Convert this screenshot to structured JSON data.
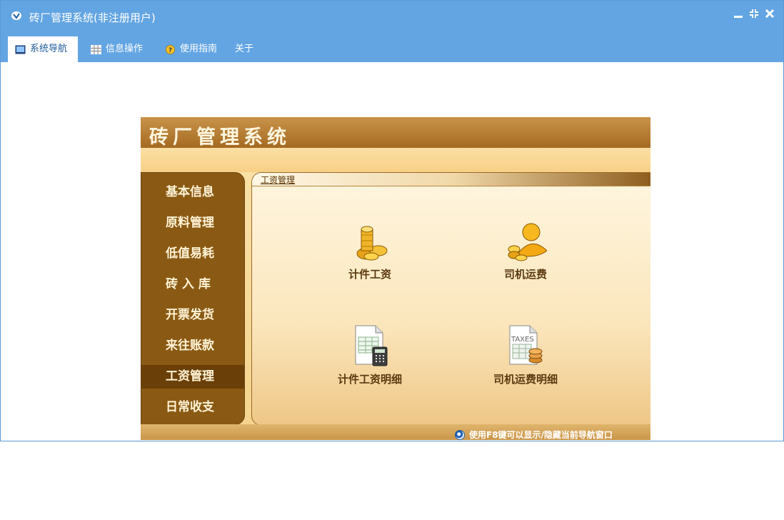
{
  "window": {
    "title": "砖厂管理系统(非注册用户)",
    "controls": {
      "minimize": "minimize-icon",
      "restore": "restore-icon",
      "close": "close-icon"
    }
  },
  "menu": {
    "items": [
      {
        "label": "系统导航",
        "icon": "monitor-icon",
        "active": true
      },
      {
        "label": "信息操作",
        "icon": "grid-icon",
        "active": false
      },
      {
        "label": "使用指南",
        "icon": "help-icon",
        "active": false
      },
      {
        "label": "关于",
        "icon": "",
        "active": false
      }
    ]
  },
  "panel": {
    "title": "砖厂管理系统",
    "nav": [
      {
        "label": "基本信息",
        "active": false
      },
      {
        "label": "原料管理",
        "active": false
      },
      {
        "label": "低值易耗",
        "active": false
      },
      {
        "label": "砖 入 库",
        "active": false
      },
      {
        "label": "开票发货",
        "active": false
      },
      {
        "label": "来往账款",
        "active": false
      },
      {
        "label": "工资管理",
        "active": true
      },
      {
        "label": "日常收支",
        "active": false
      }
    ],
    "module": {
      "title": "工资管理",
      "tiles": [
        {
          "label": "计件工资",
          "icon": "coins-icon"
        },
        {
          "label": "司机运费",
          "icon": "user-coins-icon"
        },
        {
          "label": "计件工资明细",
          "icon": "calculator-sheet-icon"
        },
        {
          "label": "司机运费明细",
          "icon": "taxes-sheet-icon"
        }
      ]
    },
    "hint": "使用F8键可以显示/隐藏当前导航窗口",
    "taxes_text": "TAXES"
  },
  "colors": {
    "titlebar": "#63a5e2",
    "nav_bg": "#8a5a14",
    "nav_active": "#6a3f08",
    "panel_header": "#a56a22"
  }
}
